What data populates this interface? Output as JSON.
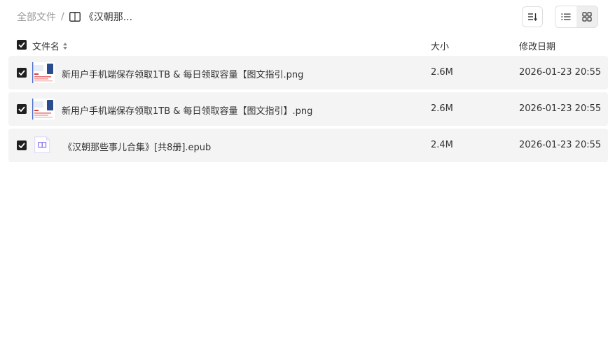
{
  "breadcrumb": {
    "root": "全部文件",
    "separator": "/",
    "current": "《汉朝那..."
  },
  "toolbar": {
    "sort_icon": "sort-icon",
    "list_view_icon": "list-view-icon",
    "grid_view_icon": "grid-view-icon"
  },
  "table": {
    "headers": {
      "name": "文件名",
      "size": "大小",
      "date": "修改日期"
    },
    "rows": [
      {
        "name": "新用户手机端保存领取1TB & 每日领取容量【图文指引.png",
        "size": "2.6M",
        "date": "2026-01-23 20:55",
        "type": "image",
        "checked": true
      },
      {
        "name": "新用户手机端保存领取1TB & 每日领取容量【图文指引】.png",
        "size": "2.6M",
        "date": "2026-01-23 20:55",
        "type": "image",
        "checked": true
      },
      {
        "name": "《汉朝那些事儿合集》[共8册].epub",
        "size": "2.4M",
        "date": "2026-01-23 20:55",
        "type": "epub",
        "checked": true
      }
    ]
  },
  "colors": {
    "row_bg": "#f4f4f4",
    "checkbox": "#1f1f1f",
    "epub_accent": "#8a7cf0",
    "muted_text": "#9a9a9a"
  }
}
